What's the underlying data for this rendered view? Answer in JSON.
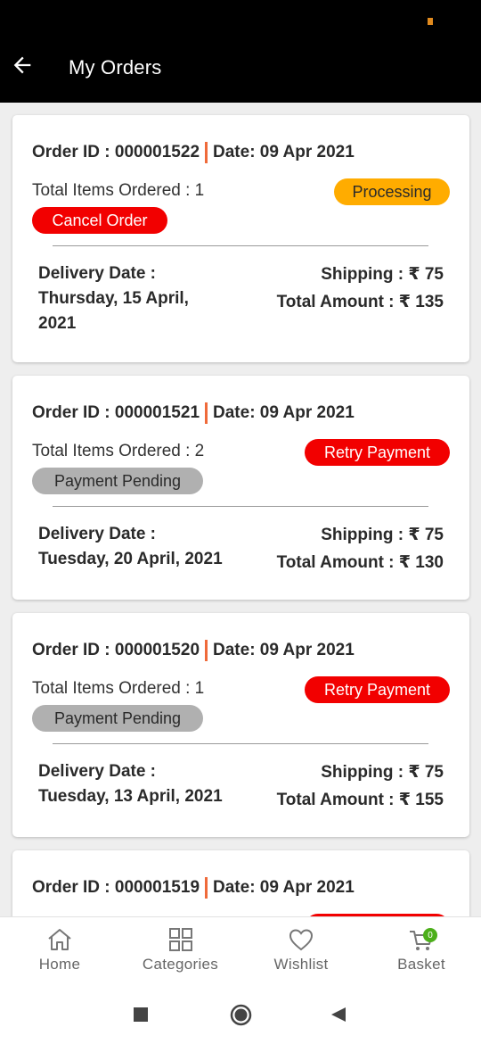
{
  "header": {
    "title": "My Orders"
  },
  "orders": [
    {
      "id_text": "Order ID : 000001522",
      "date_text": "Date: 09 Apr 2021",
      "items_text": "Total Items Ordered : 1",
      "primary_pill": "Processing",
      "secondary_pill": "Cancel Order",
      "delivery_label": "Delivery Date :",
      "delivery_value": "Thursday, 15 April, 2021",
      "shipping": "Shipping : ₹ 75",
      "total": "Total Amount : ₹ 135"
    },
    {
      "id_text": "Order ID : 000001521",
      "date_text": "Date: 09 Apr 2021",
      "items_text": "Total Items Ordered : 2",
      "primary_pill": "Retry Payment",
      "secondary_pill": "Payment Pending",
      "delivery_label": "Delivery Date :",
      "delivery_value": "Tuesday, 20 April, 2021",
      "shipping": "Shipping : ₹ 75",
      "total": "Total Amount : ₹ 130"
    },
    {
      "id_text": "Order ID : 000001520",
      "date_text": "Date: 09 Apr 2021",
      "items_text": "Total Items Ordered : 1",
      "primary_pill": "Retry Payment",
      "secondary_pill": "Payment Pending",
      "delivery_label": "Delivery Date :",
      "delivery_value": "Tuesday, 13 April, 2021",
      "shipping": "Shipping : ₹ 75",
      "total": "Total Amount : ₹ 155"
    },
    {
      "id_text": "Order ID : 000001519",
      "date_text": "Date: 09 Apr 2021"
    }
  ],
  "bottom_nav": {
    "home": "Home",
    "categories": "Categories",
    "wishlist": "Wishlist",
    "basket": "Basket",
    "basket_count": "0"
  },
  "icons": {
    "back": "arrow-left-icon",
    "home": "home-icon",
    "categories": "grid-icon",
    "wishlist": "heart-icon",
    "basket": "cart-icon"
  },
  "colors": {
    "accent_red": "#f20000",
    "processing_orange": "#ffac00",
    "pending_grey": "#b0b0b0",
    "separator_orange": "#ef6a3a",
    "badge_green": "#4caf1a"
  }
}
